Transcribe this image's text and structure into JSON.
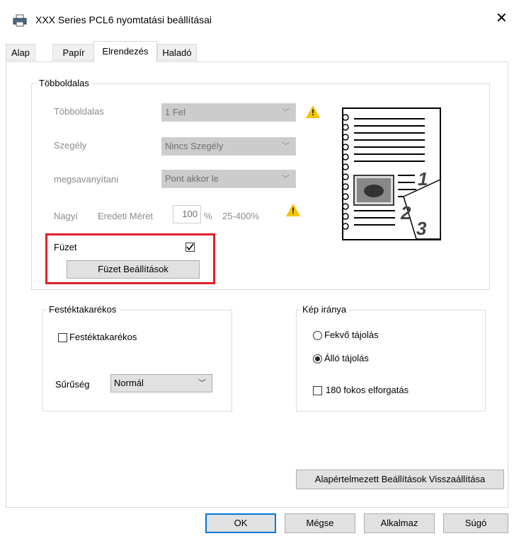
{
  "window": {
    "title": "XXX Series PCL6 nyomtatási beállításai",
    "close_glyph": "✕",
    "printer_icon": "printer-icon"
  },
  "tabs": [
    {
      "label": "Alap",
      "active": false
    },
    {
      "label": "Papír",
      "active": false
    },
    {
      "label": "Elrendezés",
      "active": true
    },
    {
      "label": "Haladó",
      "active": false
    }
  ],
  "multipage": {
    "legend": "Többoldalas",
    "rows": [
      {
        "label": "Többoldalas",
        "value": "1 Fel"
      },
      {
        "label": "Szegély",
        "value": "Nincs Szegély"
      },
      {
        "label": "megsavanyítani",
        "value": "Pont akkor le"
      }
    ],
    "scale": {
      "label": "Nagyí",
      "sublabel": "Eredeti Méret",
      "value": "100",
      "unit": "%",
      "range": "25-400%"
    },
    "booklet": {
      "label": "Füzet",
      "checked": true,
      "button": "Füzet Beállítások"
    },
    "preview_pages": [
      "1",
      "2",
      "3"
    ]
  },
  "toner": {
    "legend": "Festéktakarékos",
    "checkbox_label": "Festéktakarékos",
    "checked": false,
    "density_label": "Sűrűség",
    "density_value": "Normál"
  },
  "orientation": {
    "legend": "Kép iránya",
    "options": [
      {
        "label": "Fekvő tájolás",
        "selected": false
      },
      {
        "label": "Álló tájolás",
        "selected": true
      }
    ],
    "rotate_label": "180 fokos elforgatás",
    "rotate_checked": false
  },
  "reset_button": "Alapértelmezett Beállítások Visszaállítása",
  "footer": {
    "ok": "OK",
    "cancel": "Mégse",
    "apply": "Alkalmaz",
    "help": "Súgó"
  },
  "colors": {
    "highlight": "#e0202a",
    "accent": "#0078d7",
    "warning": "#f5c400"
  }
}
